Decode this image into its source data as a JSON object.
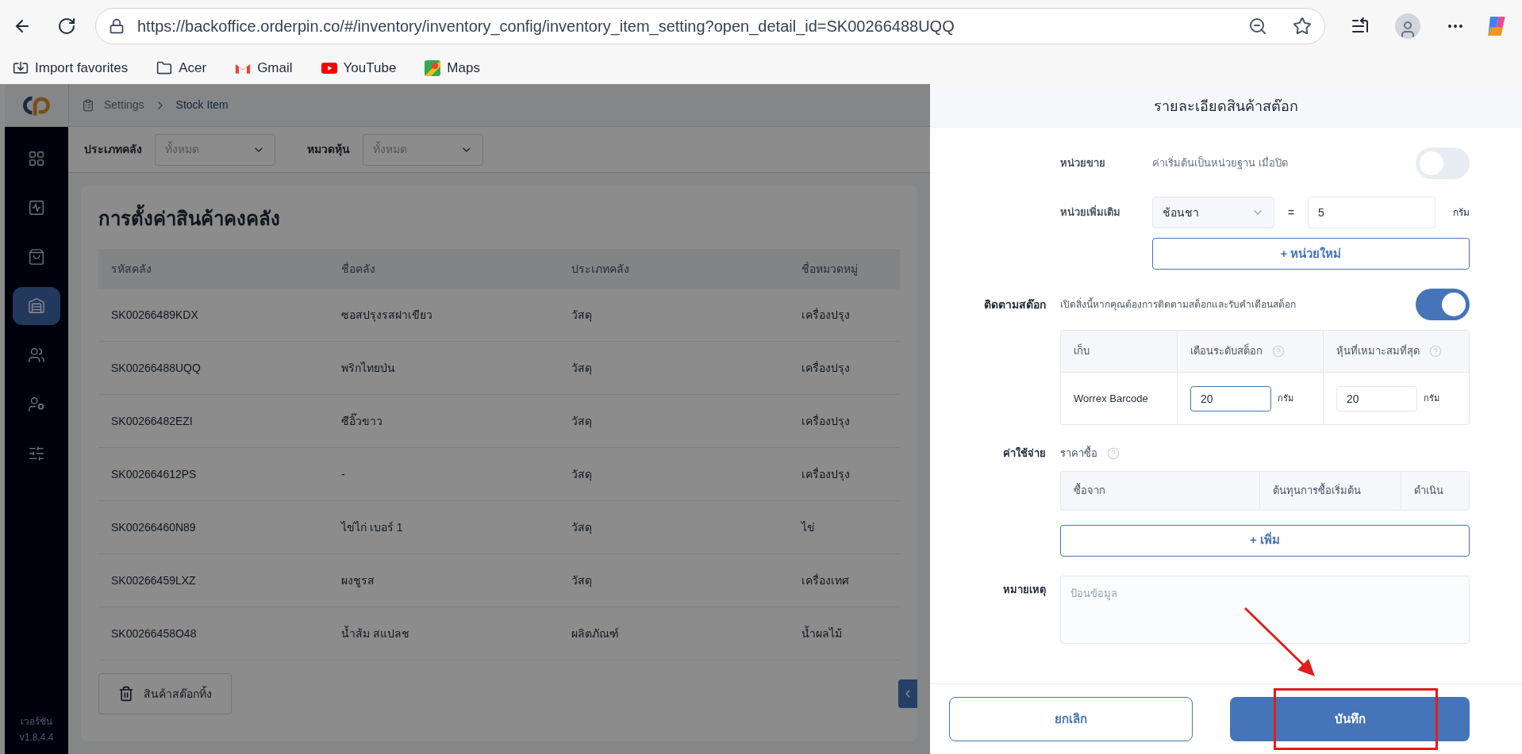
{
  "browser": {
    "url": "https://backoffice.orderpin.co/#/inventory/inventory_config/inventory_item_setting?open_detail_id=SK00266488UQQ",
    "bookmarks": [
      {
        "kind": "import",
        "label": "Import favorites"
      },
      {
        "kind": "folder",
        "label": "Acer"
      },
      {
        "kind": "gmail",
        "label": "Gmail"
      },
      {
        "kind": "youtube",
        "label": "YouTube"
      },
      {
        "kind": "maps",
        "label": "Maps"
      }
    ]
  },
  "breadcrumb": [
    "Settings",
    "Stock Item"
  ],
  "sidebar": {
    "items": [
      {
        "kind": "grid",
        "selected": false
      },
      {
        "kind": "activity",
        "selected": false
      },
      {
        "kind": "bag",
        "selected": false
      },
      {
        "kind": "warehouse",
        "selected": true
      },
      {
        "kind": "users",
        "selected": false
      },
      {
        "kind": "usergear",
        "selected": false
      },
      {
        "kind": "sliders",
        "selected": false
      }
    ],
    "version_label": "เวอร์ชัน",
    "version": "v1.8.4.4"
  },
  "filters": [
    {
      "label": "ประเภทคลัง",
      "placeholder": "ทั้งหมด"
    },
    {
      "label": "หมวดหุ้น",
      "placeholder": "ทั้งหมด"
    }
  ],
  "page_title": "การตั้งค่าสินค้าคงคลัง",
  "table": {
    "columns": [
      "รหัสคลัง",
      "ชื่อคลัง",
      "ประเภทคลัง",
      "ชื่อหมวดหมู่"
    ],
    "rows": [
      [
        "SK00266489KDX",
        "ซอสปรุงรสฝาเขียว",
        "วัสดุ",
        "เครื่องปรุง"
      ],
      [
        "SK00266488UQQ",
        "พริกไทยป่น",
        "วัสดุ",
        "เครื่องปรุง"
      ],
      [
        "SK00266482EZI",
        "ซีอิ๊วขาว",
        "วัสดุ",
        "เครื่องปรุง"
      ],
      [
        "SK002664612PS",
        "-",
        "วัสดุ",
        "เครื่องปรุง"
      ],
      [
        "SK00266460N89",
        "ไข่ไก่ เบอร์ 1",
        "วัสดุ",
        "ไข่"
      ],
      [
        "SK00266459LXZ",
        "ผงชูรส",
        "วัสดุ",
        "เครื่องเทศ"
      ],
      [
        "SK00266458O48",
        "น้ำส้ม สแปลช",
        "ผลิตภัณฑ์",
        "น้ำผลไม้"
      ]
    ]
  },
  "discard_button": "สินค้าสต๊อกทิ้ง",
  "panel": {
    "title": "รายละเอียดสินค้าสต๊อก",
    "sell_unit": {
      "label": "หน่วยขาย",
      "hint": "ค่าเริ่มต้นเป็นหน่วยฐาน เมื่อปิด",
      "on": false
    },
    "extra_unit": {
      "label": "หน่วยเพิ่มเติม",
      "unit": "ช้อนชา",
      "equals": "=",
      "amount": "5",
      "base_unit": "กรัม",
      "add_button": "+ หน่วยใหม่"
    },
    "tracking": {
      "label": "ติดตามสต๊อก",
      "hint": "เปิดสิ่งนี้หากคุณต้องการติดตามสต็อกและรับคำเตือนสต็อก",
      "on": true,
      "columns": [
        {
          "label": "เก็บ",
          "help": false
        },
        {
          "label": "เตือนระดับสต็อก",
          "help": true
        },
        {
          "label": "หุ้นที่เหมาะสมที่สุด",
          "help": true
        }
      ],
      "rows": [
        {
          "store": "Worrex Barcode",
          "fields": [
            {
              "value": "20",
              "unit": "กรัม",
              "focused": true
            },
            {
              "value": "20",
              "unit": "กรัม",
              "focused": false
            }
          ]
        }
      ]
    },
    "cost": {
      "label": "ค่าใช้จ่าย",
      "sublabel": "ราคาซื้อ",
      "columns": [
        "ซื้อจาก",
        "ต้นทุนการซื้อเริ่มต้น",
        "ดำเนิน"
      ],
      "add_button": "+ เพิ่ม"
    },
    "note": {
      "label": "หมายเหตุ",
      "placeholder": "ป้อนข้อมูล"
    },
    "cancel_button": "ยกเลิก",
    "save_button": "บันทึก"
  }
}
